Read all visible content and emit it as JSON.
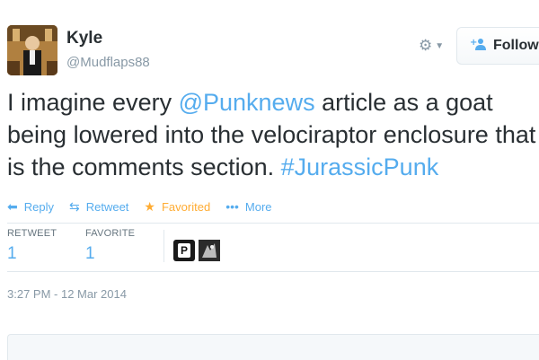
{
  "user": {
    "name": "Kyle",
    "handle": "@Mudflaps88",
    "avatar_icon": "user-avatar-photo"
  },
  "header": {
    "gear_icon": "gear-icon",
    "follow_label": "Follow",
    "follow_icon": "add-user-icon"
  },
  "tweet": {
    "text_before": "I imagine every ",
    "mention": "@Punknews",
    "text_middle": " article as a goat being lowered into the velociraptor enclosure that is the comments section. ",
    "hashtag": "#JurassicPunk"
  },
  "actions": {
    "reply_label": "Reply",
    "retweet_label": "Retweet",
    "favorited_label": "Favorited",
    "more_label": "More"
  },
  "stats": {
    "retweet_label": "RETWEET",
    "retweet_count": "1",
    "favorite_label": "FAVORITE",
    "favorite_count": "1"
  },
  "timestamp": "3:27 PM - 12 Mar 2014",
  "colors": {
    "link": "#55acee",
    "favorite": "#ffac33",
    "text": "#292f33",
    "muted": "#8899a6"
  }
}
